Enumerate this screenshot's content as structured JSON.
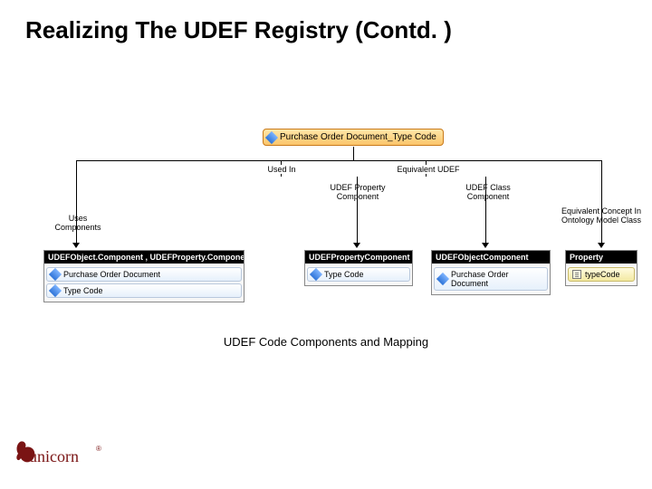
{
  "title": "Realizing The UDEF Registry (Contd. )",
  "diagram": {
    "top_node": "Purchase Order Document_Type Code",
    "relations": {
      "uses_components": "Uses Components",
      "used_in": "Used In",
      "udef_property_component": "UDEF Property\nComponent",
      "equivalent_udef": "Equivalent UDEF",
      "udef_class_component": "UDEF Class Component",
      "equivalent_concept": "Equivalent Concept In\nOntology Model Class"
    },
    "panels": {
      "uses": {
        "header": "UDEFObject.Component , UDEFProperty.Component",
        "items": [
          "Purchase Order Document",
          "Type Code"
        ]
      },
      "prop": {
        "header": "UDEFPropertyComponent",
        "items": [
          "Type Code"
        ]
      },
      "class": {
        "header": "UDEFObjectComponent",
        "items": [
          "Purchase Order Document"
        ]
      },
      "property": {
        "header": "Property",
        "items": [
          "typeCode"
        ]
      }
    }
  },
  "caption": "UDEF Code Components and Mapping",
  "logo_text": "unicorn"
}
